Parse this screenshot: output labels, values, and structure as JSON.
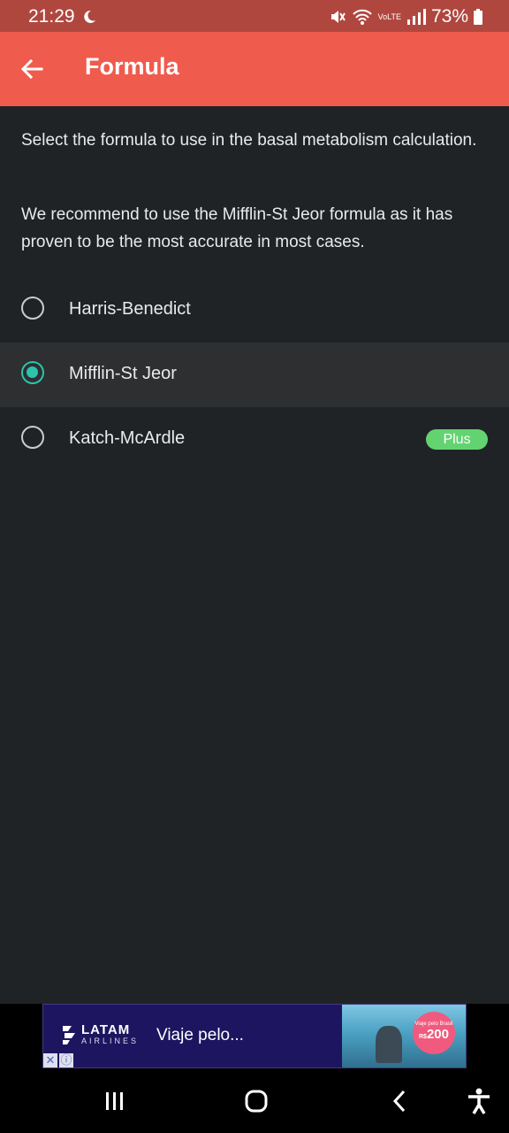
{
  "status_bar": {
    "time": "21:29",
    "network": "VoLTE",
    "battery": "73%",
    "icons": [
      "moon-icon",
      "mute-icon",
      "wifi-icon",
      "signal-icon",
      "battery-icon"
    ]
  },
  "app_bar": {
    "title": "Formula",
    "back_icon": "arrow-left-icon",
    "color": "#ef5b4d"
  },
  "content": {
    "description": "Select the formula to use in the basal metabolism calculation.",
    "recommendation": "We recommend to use the Mifflin-St Jeor formula as it has proven to be the most accurate in most cases."
  },
  "options": [
    {
      "label": "Harris-Benedict",
      "selected": false,
      "badge": ""
    },
    {
      "label": "Mifflin-St Jeor",
      "selected": true,
      "badge": ""
    },
    {
      "label": "Katch-McArdle",
      "selected": false,
      "badge": "Plus"
    }
  ],
  "accent_color": "#2cc2ac",
  "ad": {
    "brand": "LATAM",
    "brand_sub": "AIRLINES",
    "headline": "Viaje pelo...",
    "price_caption": "Viaje pelo Brasil",
    "price": "200",
    "price_currency": "R$"
  },
  "nav_bar": {
    "icons": [
      "recent-apps-icon",
      "home-icon",
      "back-icon",
      "accessibility-icon"
    ]
  }
}
